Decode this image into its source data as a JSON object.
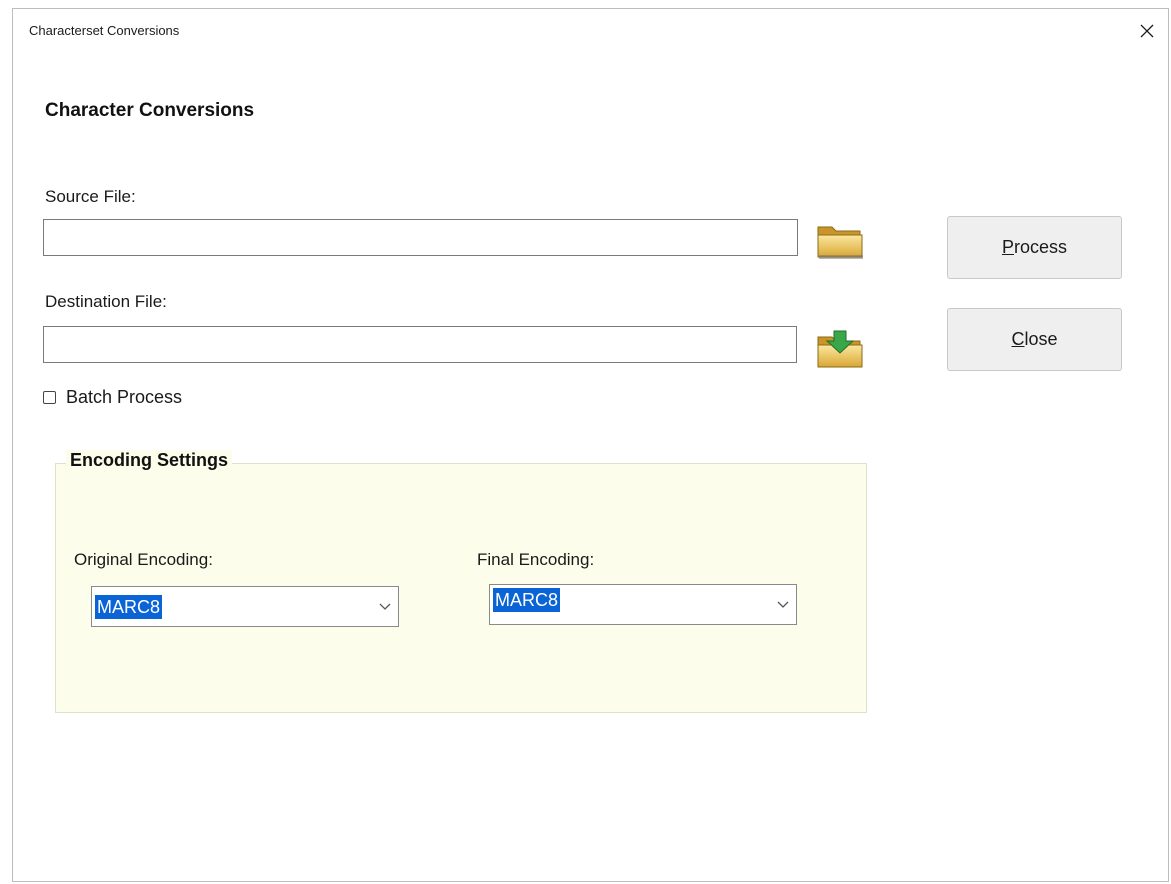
{
  "window": {
    "title": "Characterset Conversions"
  },
  "heading": "Character Conversions",
  "source": {
    "label": "Source File:",
    "value": "",
    "browse_icon": "folder-open-icon"
  },
  "destination": {
    "label": "Destination File:",
    "value": "",
    "browse_icon": "folder-save-icon"
  },
  "batch": {
    "label": "Batch Process",
    "checked": false
  },
  "buttons": {
    "process": {
      "mnemonic": "P",
      "rest": "rocess"
    },
    "close": {
      "mnemonic": "C",
      "rest": "lose"
    }
  },
  "encoding": {
    "group_title": "Encoding Settings",
    "original_label": "Original Encoding:",
    "original_value": "MARC8",
    "final_label": "Final Encoding:",
    "final_value": "MARC8"
  },
  "colors": {
    "selection": "#0a64d6",
    "group_background": "#fdfdeb",
    "button_face": "#efefef"
  }
}
